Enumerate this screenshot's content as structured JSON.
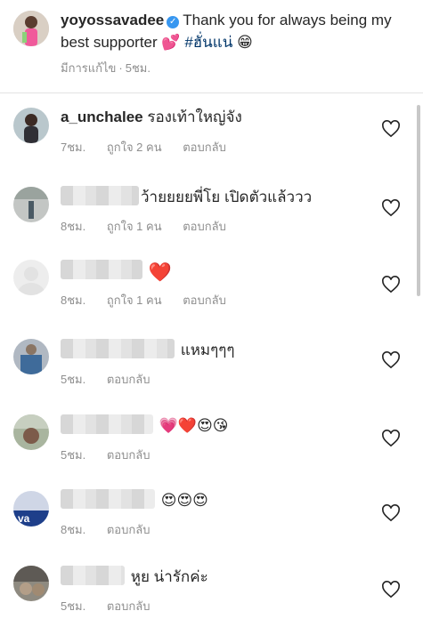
{
  "caption": {
    "username": "yoyossavadee",
    "text": "Thank you for always being my best supporter",
    "heart_emoji": "💕",
    "hashtag": "#ฮั่นแน่",
    "grin_emoji": "😁",
    "edited_label": "มีการแก้ไข",
    "separator": "·",
    "time": "5ชม."
  },
  "comments": [
    {
      "username": "a_unchalee",
      "text": "รองเท้าใหญ่จัง",
      "time": "7ชม.",
      "likes": "ถูกใจ 2 คน",
      "reply": "ตอบกลับ"
    },
    {
      "username": "",
      "text": "ว้ายยยยพี่โย เปิดตัวแล้ววว",
      "time": "8ชม.",
      "likes": "ถูกใจ 1 คน",
      "reply": "ตอบกลับ"
    },
    {
      "username": "",
      "emoji": "❤️",
      "time": "8ชม.",
      "likes": "ถูกใจ 1 คน",
      "reply": "ตอบกลับ"
    },
    {
      "username": "",
      "text": "แหมๆๆๆ",
      "time": "5ชม.",
      "reply": "ตอบกลับ"
    },
    {
      "username": "",
      "emoji": "💗❤️😍😘",
      "time": "5ชม.",
      "reply": "ตอบกลับ"
    },
    {
      "username": "",
      "emoji": "😍😍😍",
      "time": "8ชม.",
      "reply": "ตอบกลับ"
    },
    {
      "username": "",
      "text": "หูย น่ารักค่ะ",
      "time": "5ชม.",
      "reply": "ตอบกลับ"
    }
  ],
  "icons": {
    "like": "heart-outline-icon",
    "verified": "verified-badge-icon"
  },
  "colors": {
    "text": "#262626",
    "meta": "#8e8e8e",
    "verified": "#3897f0",
    "heart": "#e8264d"
  }
}
